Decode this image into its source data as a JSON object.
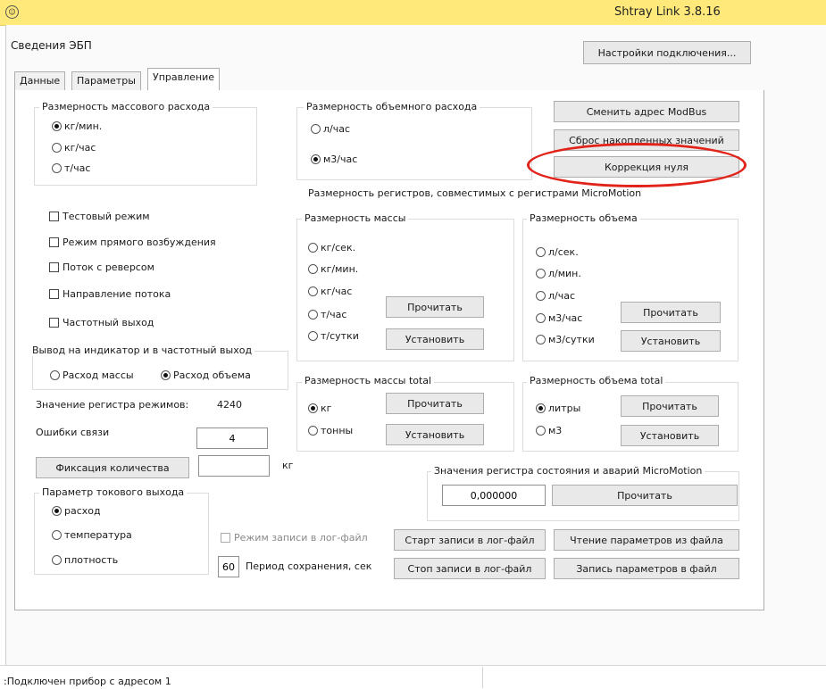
{
  "window": {
    "title": "Shtray Link 3.8.16",
    "app_icon_glyph": "☺"
  },
  "header": {
    "section_label": "Сведения ЭБП",
    "connection_button": "Настройки подключения..."
  },
  "tabs": [
    {
      "label": "Данные",
      "active": false
    },
    {
      "label": "Параметры",
      "active": false
    },
    {
      "label": "Управление",
      "active": true
    }
  ],
  "mass_flow_units": {
    "title": "Размерность массового расхода",
    "options": [
      {
        "label": "кг/мин.",
        "selected": true
      },
      {
        "label": "кг/час",
        "selected": false
      },
      {
        "label": "т/час",
        "selected": false
      }
    ]
  },
  "volume_flow_units": {
    "title": "Размерность объемного расхода",
    "options": [
      {
        "label": "л/час",
        "selected": false
      },
      {
        "label": "м3/час",
        "selected": true
      }
    ]
  },
  "actions": {
    "change_modbus": "Сменить адрес ModBus",
    "reset_accumulated": "Сброс накопленных значений",
    "zero_correction": "Коррекция нуля"
  },
  "micromotion_registers_heading": "Размерность регистров, совместимых с регистрами MicroMotion",
  "checkboxes": [
    {
      "label": "Тестовый режим",
      "checked": false
    },
    {
      "label": "Режим прямого возбуждения",
      "checked": false
    },
    {
      "label": "Поток с реверсом",
      "checked": false
    },
    {
      "label": "Направление потока",
      "checked": false
    },
    {
      "label": "Частотный выход",
      "checked": false
    }
  ],
  "mass_units": {
    "title": "Размерность массы",
    "options": [
      {
        "label": "кг/сек.",
        "selected": false
      },
      {
        "label": "кг/мин.",
        "selected": false
      },
      {
        "label": "кг/час",
        "selected": false
      },
      {
        "label": "т/час",
        "selected": false
      },
      {
        "label": "т/сутки",
        "selected": false
      }
    ],
    "read_button": "Прочитать",
    "set_button": "Установить"
  },
  "volume_units": {
    "title": "Размерность объема",
    "options": [
      {
        "label": "л/сек.",
        "selected": false
      },
      {
        "label": "л/мин.",
        "selected": false
      },
      {
        "label": "л/час",
        "selected": false
      },
      {
        "label": "м3/час",
        "selected": false
      },
      {
        "label": "м3/сутки",
        "selected": false
      }
    ],
    "read_button": "Прочитать",
    "set_button": "Установить"
  },
  "indicator_output": {
    "title": "Вывод на индикатор  и в частотный выход",
    "options": [
      {
        "label": "Расход массы",
        "selected": false
      },
      {
        "label": "Расход объема",
        "selected": true
      }
    ]
  },
  "mass_total_units": {
    "title": "Размерность массы total",
    "options": [
      {
        "label": "кг",
        "selected": true
      },
      {
        "label": "тонны",
        "selected": false
      }
    ],
    "read_button": "Прочитать",
    "set_button": "Установить"
  },
  "volume_total_units": {
    "title": "Размерность объема total",
    "options": [
      {
        "label": "литры",
        "selected": true
      },
      {
        "label": "м3",
        "selected": false
      }
    ],
    "read_button": "Прочитать",
    "set_button": "Установить"
  },
  "mode_register": {
    "label": "Значение регистра режимов:",
    "value": "4240"
  },
  "comm_errors": {
    "label": "Ошибки связи",
    "value": "4"
  },
  "quantity_fix": {
    "button": "Фиксация количества",
    "value": "",
    "unit": "кг"
  },
  "current_output": {
    "title": "Параметр токового выхода",
    "options": [
      {
        "label": "расход",
        "selected": true
      },
      {
        "label": "температура",
        "selected": false
      },
      {
        "label": "плотность",
        "selected": false
      }
    ]
  },
  "status_register": {
    "title": "Значения регистра состояния и аварий MicroMotion",
    "value": "0,000000",
    "read_button": "Прочитать"
  },
  "logging": {
    "log_mode_label": "Режим записи в лог-файл",
    "period_value": "60",
    "period_label": "Период сохранения, сек",
    "start_button": "Старт записи в лог-файл",
    "stop_button": "Стоп записи в лог-файл",
    "read_params_button": "Чтение параметров из файла",
    "write_params_button": "Запись параметров в файл"
  },
  "status_bar": {
    "message": ":Подключен прибор с адресом 1"
  },
  "colors": {
    "titlebar": "#ffe97a",
    "annotation": "#e2231a"
  }
}
